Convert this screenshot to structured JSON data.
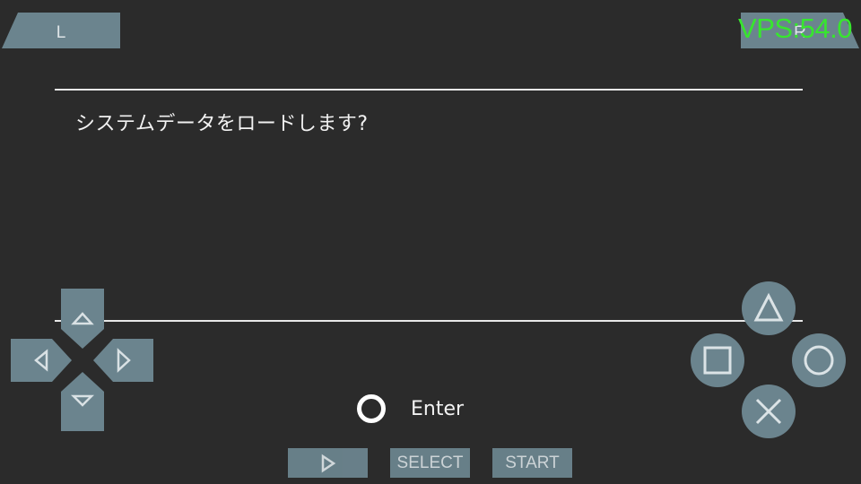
{
  "dialog": {
    "message": "システムデータをロードします?",
    "confirm_label": "Enter"
  },
  "overlay": {
    "fps_readout": "VPS:54.0",
    "shoulder_left_label": "L",
    "shoulder_right_label": "R",
    "select_label": "SELECT",
    "start_label": "START",
    "button_color": "#6b848e",
    "fps_color": "#37e62e"
  }
}
